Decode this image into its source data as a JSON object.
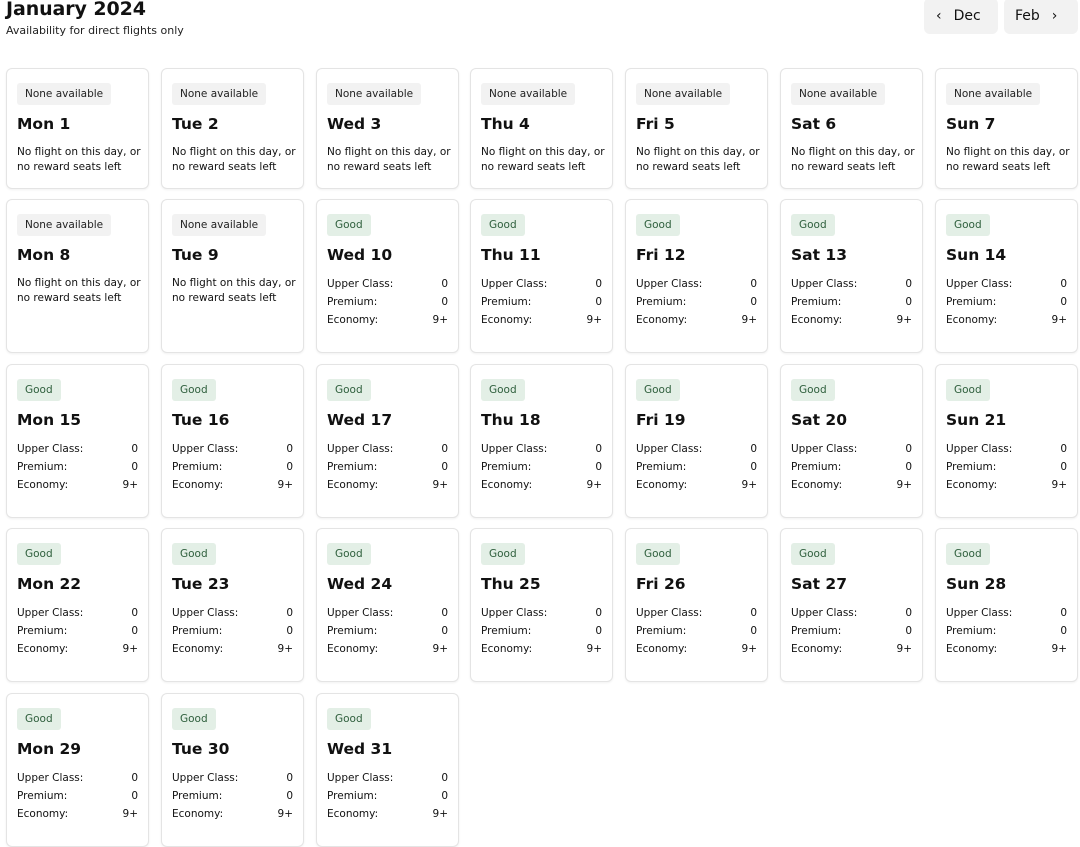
{
  "header": {
    "title": "January 2024",
    "subtitle": "Availability for direct flights only",
    "prev_label": "Dec",
    "next_label": "Feb"
  },
  "labels": {
    "upper": "Upper Class:",
    "premium": "Premium:",
    "economy": "Economy:",
    "no_flight": "No flight on this day, or no reward seats left"
  },
  "colors": {
    "good_badge_bg": "#e3efe6",
    "good_badge_text": "#2e5e3c",
    "none_badge_bg": "#f2f2f2"
  },
  "days": [
    {
      "label": "Mon 1",
      "status": "None available"
    },
    {
      "label": "Tue 2",
      "status": "None available"
    },
    {
      "label": "Wed 3",
      "status": "None available"
    },
    {
      "label": "Thu 4",
      "status": "None available"
    },
    {
      "label": "Fri 5",
      "status": "None available"
    },
    {
      "label": "Sat 6",
      "status": "None available"
    },
    {
      "label": "Sun 7",
      "status": "None available"
    },
    {
      "label": "Mon 8",
      "status": "None available"
    },
    {
      "label": "Tue 9",
      "status": "None available"
    },
    {
      "label": "Wed 10",
      "status": "Good",
      "upper": "0",
      "premium": "0",
      "economy": "9+"
    },
    {
      "label": "Thu 11",
      "status": "Good",
      "upper": "0",
      "premium": "0",
      "economy": "9+"
    },
    {
      "label": "Fri 12",
      "status": "Good",
      "upper": "0",
      "premium": "0",
      "economy": "9+"
    },
    {
      "label": "Sat 13",
      "status": "Good",
      "upper": "0",
      "premium": "0",
      "economy": "9+"
    },
    {
      "label": "Sun 14",
      "status": "Good",
      "upper": "0",
      "premium": "0",
      "economy": "9+"
    },
    {
      "label": "Mon 15",
      "status": "Good",
      "upper": "0",
      "premium": "0",
      "economy": "9+"
    },
    {
      "label": "Tue 16",
      "status": "Good",
      "upper": "0",
      "premium": "0",
      "economy": "9+"
    },
    {
      "label": "Wed 17",
      "status": "Good",
      "upper": "0",
      "premium": "0",
      "economy": "9+"
    },
    {
      "label": "Thu 18",
      "status": "Good",
      "upper": "0",
      "premium": "0",
      "economy": "9+"
    },
    {
      "label": "Fri 19",
      "status": "Good",
      "upper": "0",
      "premium": "0",
      "economy": "9+"
    },
    {
      "label": "Sat 20",
      "status": "Good",
      "upper": "0",
      "premium": "0",
      "economy": "9+"
    },
    {
      "label": "Sun 21",
      "status": "Good",
      "upper": "0",
      "premium": "0",
      "economy": "9+"
    },
    {
      "label": "Mon 22",
      "status": "Good",
      "upper": "0",
      "premium": "0",
      "economy": "9+"
    },
    {
      "label": "Tue 23",
      "status": "Good",
      "upper": "0",
      "premium": "0",
      "economy": "9+"
    },
    {
      "label": "Wed 24",
      "status": "Good",
      "upper": "0",
      "premium": "0",
      "economy": "9+"
    },
    {
      "label": "Thu 25",
      "status": "Good",
      "upper": "0",
      "premium": "0",
      "economy": "9+"
    },
    {
      "label": "Fri 26",
      "status": "Good",
      "upper": "0",
      "premium": "0",
      "economy": "9+"
    },
    {
      "label": "Sat 27",
      "status": "Good",
      "upper": "0",
      "premium": "0",
      "economy": "9+"
    },
    {
      "label": "Sun 28",
      "status": "Good",
      "upper": "0",
      "premium": "0",
      "economy": "9+"
    },
    {
      "label": "Mon 29",
      "status": "Good",
      "upper": "0",
      "premium": "0",
      "economy": "9+"
    },
    {
      "label": "Tue 30",
      "status": "Good",
      "upper": "0",
      "premium": "0",
      "economy": "9+"
    },
    {
      "label": "Wed 31",
      "status": "Good",
      "upper": "0",
      "premium": "0",
      "economy": "9+"
    }
  ]
}
